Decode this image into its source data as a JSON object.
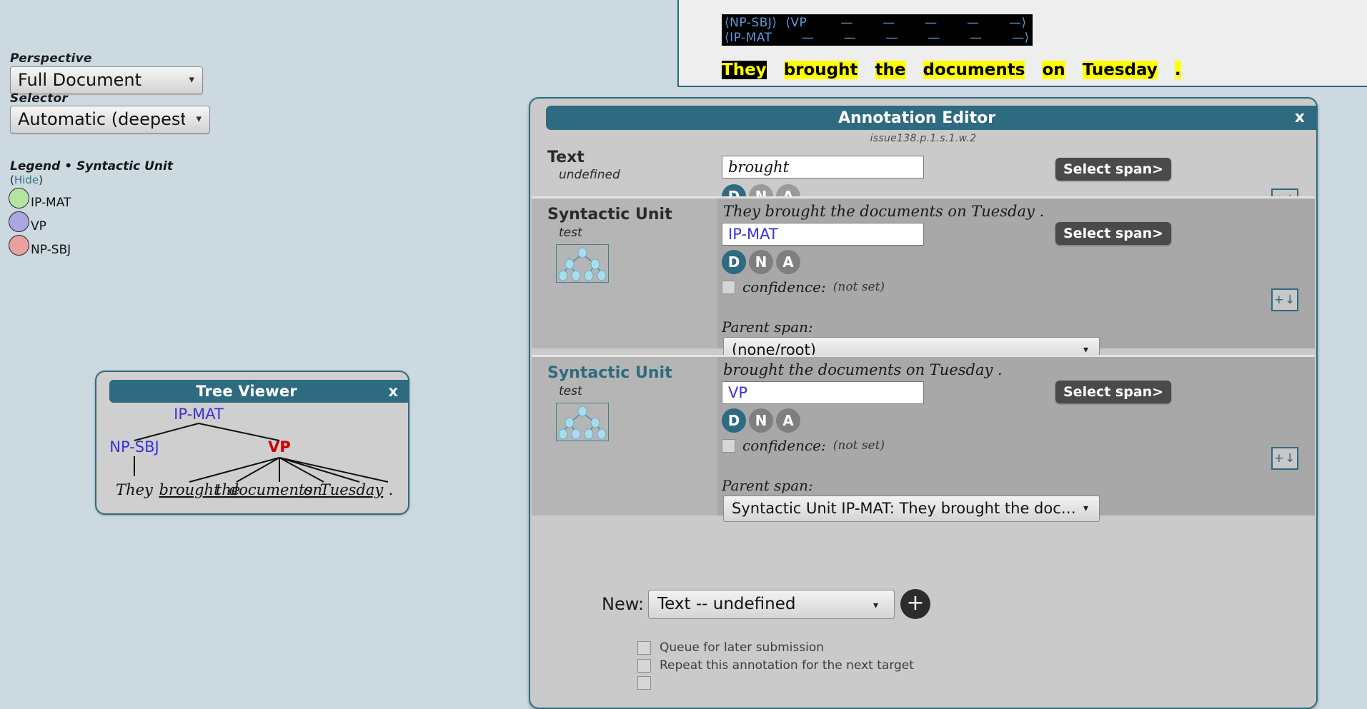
{
  "controls": {
    "perspective_label": "Perspective",
    "perspective_value": "Full Document",
    "selector_label": "Selector",
    "selector_value": "Automatic (deepest)"
  },
  "legend": {
    "title": "Legend • Syntactic Unit",
    "hide_open": "(",
    "hide_link": "Hide",
    "hide_close": ")",
    "items": [
      {
        "label": "IP-MAT",
        "color": "#b5e3a0"
      },
      {
        "label": "VP",
        "color": "#a9a6e0"
      },
      {
        "label": "NP-SBJ",
        "color": "#e8a0a0"
      }
    ]
  },
  "tree_viewer": {
    "title": "Tree Viewer",
    "close_label": "x",
    "root": "IP-MAT",
    "root_color": "#3a30d8",
    "left_node": "NP-SBJ",
    "left_node_color": "#3a30d8",
    "right_node": "VP",
    "right_node_color": "#cc0000",
    "leaves": [
      "They",
      "brought",
      "the",
      "documents",
      "on",
      "Tuesday",
      "."
    ]
  },
  "document": {
    "parse_line_1": "⟨NP-SBJ⟩  ⟨VP        —       —       —       —       —⟩",
    "parse_line_2": "⟨IP-MAT       —       —       —       —       —       —⟩",
    "words": [
      {
        "text": "They",
        "state": "selected"
      },
      {
        "text": " ",
        "state": "gap"
      },
      {
        "text": "brought",
        "state": "highlight"
      },
      {
        "text": " ",
        "state": "gap"
      },
      {
        "text": "the",
        "state": "highlight"
      },
      {
        "text": " ",
        "state": "gap"
      },
      {
        "text": "documents",
        "state": "highlight"
      },
      {
        "text": " ",
        "state": "gap"
      },
      {
        "text": "on",
        "state": "highlight"
      },
      {
        "text": " ",
        "state": "gap"
      },
      {
        "text": "Tuesday",
        "state": "highlight"
      },
      {
        "text": " ",
        "state": "gap"
      },
      {
        "text": ".",
        "state": "highlight"
      }
    ]
  },
  "annotation_editor": {
    "title": "Annotation Editor",
    "subtitle": "issue138.p.1.s.1.w.2",
    "close_label": "x",
    "text_row": {
      "label": "Text",
      "sublabel": "undefined",
      "value": "brought",
      "select_span_label": "Select span>",
      "dna": [
        "D",
        "N",
        "A"
      ],
      "dna_active": "D",
      "plus_down": "+↓"
    },
    "sections": [
      {
        "label": "Syntactic Unit",
        "label_color": "#2b2b2b",
        "sublabel": "test",
        "span_text": "They brought the documents on Tuesday .",
        "value": "IP-MAT",
        "select_span_label": "Select span>",
        "dna": [
          "D",
          "N",
          "A"
        ],
        "dna_active": "D",
        "confidence_label": "confidence:",
        "confidence_value": "(not set)",
        "parent_label": "Parent span:",
        "parent_value": "(none/root)",
        "plus_down": "+↓"
      },
      {
        "label": "Syntactic Unit",
        "label_color": "#2e6a80",
        "sublabel": "test",
        "span_text": "brought the documents on Tuesday .",
        "value": "VP",
        "select_span_label": "Select span>",
        "dna": [
          "D",
          "N",
          "A"
        ],
        "dna_active": "D",
        "confidence_label": "confidence:",
        "confidence_value": "(not set)",
        "parent_label": "Parent span:",
        "parent_value": "Syntactic Unit IP-MAT: They brought the docume",
        "plus_down": "+↓"
      }
    ],
    "new_row": {
      "label": "New:",
      "value": "Text -- undefined",
      "add_label": "+"
    },
    "checkboxes": [
      {
        "label": "Queue for later submission"
      },
      {
        "label": "Repeat this annotation for the next target"
      }
    ]
  }
}
